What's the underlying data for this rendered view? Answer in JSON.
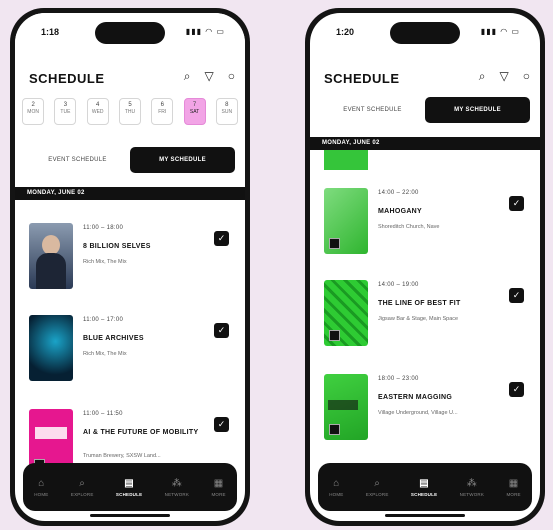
{
  "left": {
    "status": {
      "time": "1:18",
      "icons": "▮▮▮ ◠ ▭"
    },
    "title": "SCHEDULE",
    "days": [
      {
        "num": "2",
        "label": "MON"
      },
      {
        "num": "3",
        "label": "TUE"
      },
      {
        "num": "4",
        "label": "WED"
      },
      {
        "num": "5",
        "label": "THU"
      },
      {
        "num": "6",
        "label": "FRI"
      },
      {
        "num": "7",
        "label": "SAT"
      },
      {
        "num": "8",
        "label": "SUN"
      }
    ],
    "tabs": {
      "event": "EVENT SCHEDULE",
      "my": "MY SCHEDULE"
    },
    "date_bar": "MONDAY, JUNE 02",
    "events": [
      {
        "time": "11:00  –  18:00",
        "title": "8 BILLION SELVES",
        "venue": "Rich Mix, The Mix"
      },
      {
        "time": "11:00  –  17:00",
        "title": "BLUE ARCHIVES",
        "venue": "Rich Mix, The Mix"
      },
      {
        "time": "11:00  –  11:50",
        "title": "AI & THE FUTURE OF MOBILITY",
        "venue": "Truman Brewery, SXSW Land..."
      }
    ]
  },
  "right": {
    "status": {
      "time": "1:20",
      "icons": "▮▮▮ ◠ ▭"
    },
    "title": "SCHEDULE",
    "tabs": {
      "event": "EVENT SCHEDULE",
      "my": "MY SCHEDULE"
    },
    "date_bar": "MONDAY, JUNE 02",
    "events": [
      {
        "time": "14:00  –  22:00",
        "title": "MAHOGANY",
        "venue": "Shoreditch Church, Nave"
      },
      {
        "time": "14:00  –  19:00",
        "title": "THE LINE OF BEST FIT",
        "venue": "Jigsaw Bar & Stage, Main Space"
      },
      {
        "time": "18:00  –  23:00",
        "title": "EASTERN MAGGING",
        "venue": "Village Underground, Village U..."
      }
    ]
  },
  "tabbar": [
    {
      "icon": "home-icon",
      "label": "HOME"
    },
    {
      "icon": "search-icon",
      "label": "EXPLORE"
    },
    {
      "icon": "calendar-icon",
      "label": "SCHEDULE"
    },
    {
      "icon": "network-icon",
      "label": "NETWORK"
    },
    {
      "icon": "grid-icon",
      "label": "MORE"
    }
  ],
  "colors": {
    "accent_pink": "#f2a4e6",
    "green": "#3dd13d",
    "dark": "#111111"
  }
}
